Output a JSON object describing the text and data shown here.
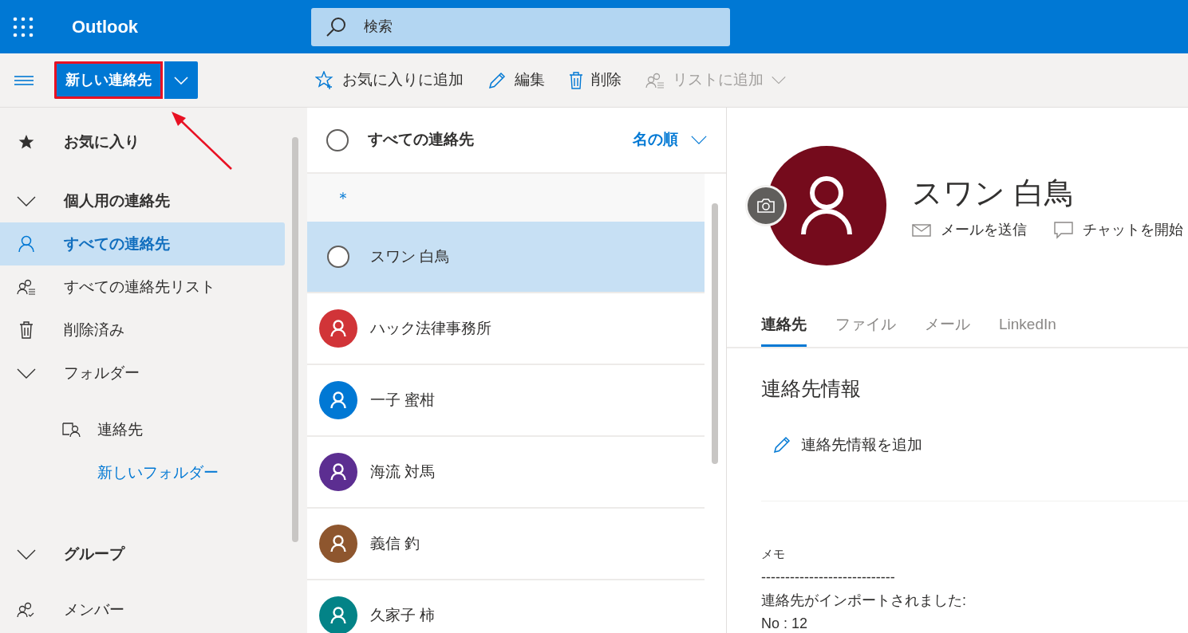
{
  "app_bar": {
    "title": "Outlook",
    "search": {
      "placeholder": "検索"
    }
  },
  "toolbar": {
    "new_button": {
      "label": "新しい連絡先"
    },
    "actions": [
      {
        "kind": "favorite",
        "label": "お気に入りに追加",
        "disabled": false
      },
      {
        "kind": "edit",
        "label": "編集",
        "disabled": false
      },
      {
        "kind": "delete",
        "label": "削除",
        "disabled": false
      },
      {
        "kind": "add-to-list",
        "label": "リストに追加",
        "disabled": true
      }
    ]
  },
  "sidebar": {
    "items": [
      {
        "kind": "favorites",
        "label": "お気に入り"
      },
      {
        "kind": "section",
        "label": "個人用の連絡先",
        "expanded": true,
        "children": [
          {
            "kind": "contacts",
            "label": "すべての連絡先",
            "selected": true
          },
          {
            "kind": "lists",
            "label": "すべての連絡先リスト",
            "selected": false
          },
          {
            "kind": "deleted",
            "label": "削除済み",
            "selected": false
          },
          {
            "kind": "subsection",
            "label": "フォルダー",
            "expanded": true,
            "children": [
              {
                "kind": "folder",
                "label": "連絡先",
                "selected": false
              },
              {
                "kind": "new-folder",
                "label": "新しいフォルダー"
              }
            ]
          }
        ]
      },
      {
        "kind": "section",
        "label": "グループ",
        "expanded": true,
        "children": [
          {
            "kind": "members",
            "label": "メンバー",
            "selected": false
          }
        ]
      }
    ]
  },
  "contact_list": {
    "all_selected": false,
    "title": "すべての連絡先",
    "sort": "名の順",
    "group": "＊",
    "rows": [
      {
        "name": "スワン 白鳥",
        "selected": true,
        "color": "#750b1c"
      },
      {
        "name": "ハック法律事務所",
        "selected": false,
        "color": "#d13438"
      },
      {
        "name": "一子 蜜柑",
        "selected": false,
        "color": "#0078d4"
      },
      {
        "name": "海流 対馬",
        "selected": false,
        "color": "#5c2e91"
      },
      {
        "name": "義信 釣",
        "selected": false,
        "color": "#8e562e"
      },
      {
        "name": "久家子 柿",
        "selected": false,
        "color": "#038387"
      }
    ]
  },
  "detail": {
    "name": "スワン 白鳥",
    "actions": [
      {
        "kind": "mail",
        "label": "メールを送信"
      },
      {
        "kind": "chat",
        "label": "チャットを開始"
      }
    ],
    "tabs": [
      {
        "label": "連絡先",
        "selected": true
      },
      {
        "label": "ファイル",
        "selected": false
      },
      {
        "label": "メール",
        "selected": false
      },
      {
        "label": "LinkedIn",
        "selected": false
      }
    ],
    "section_title": "連絡先情報",
    "add_link": "連絡先情報を追加",
    "memo": {
      "label": "メモ",
      "lines": [
        "----------------------------",
        "連絡先がインポートされました:",
        "No : 12"
      ]
    }
  }
}
